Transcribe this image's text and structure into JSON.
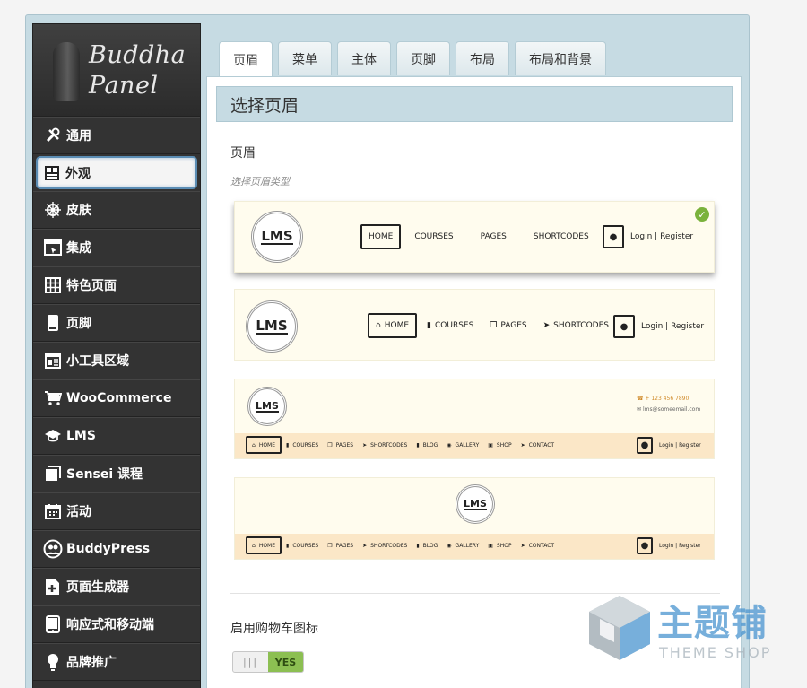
{
  "logo": {
    "line1": "Buddha",
    "line2": "Panel"
  },
  "sidebar": {
    "items": [
      {
        "label": "通用",
        "icon": "wrench-icon"
      },
      {
        "label": "外观",
        "icon": "layout-icon",
        "active": true
      },
      {
        "label": "皮肤",
        "icon": "helm-icon"
      },
      {
        "label": "集成",
        "icon": "integration-window-icon"
      },
      {
        "label": "特色页面",
        "icon": "grid-icon"
      },
      {
        "label": "页脚",
        "icon": "mobile-page-icon"
      },
      {
        "label": "小工具区域",
        "icon": "widget-layout-icon"
      },
      {
        "label": "WooCommerce",
        "icon": "cart-icon"
      },
      {
        "label": "LMS",
        "icon": "graduation-cap-icon"
      },
      {
        "label": "Sensei 课程",
        "icon": "book-stack-icon"
      },
      {
        "label": "活动",
        "icon": "calendar-icon"
      },
      {
        "label": "BuddyPress",
        "icon": "buddypress-icon"
      },
      {
        "label": "页面生成器",
        "icon": "page-builder-icon"
      },
      {
        "label": "响应式和移动端",
        "icon": "tablet-icon"
      },
      {
        "label": "品牌推广",
        "icon": "lightbulb-icon"
      }
    ]
  },
  "tabs": [
    {
      "label": "页眉",
      "active": true
    },
    {
      "label": "菜单"
    },
    {
      "label": "主体"
    },
    {
      "label": "页脚"
    },
    {
      "label": "布局"
    },
    {
      "label": "布局和背景"
    }
  ],
  "main": {
    "section_title": "选择页眉",
    "field_label": "页眉",
    "field_hint": "选择页眉类型",
    "cart_label": "启用购物车图标",
    "toggle_off": "|||",
    "toggle_yes": "YES"
  },
  "headers": {
    "logo_text": "LMS",
    "login": "Login",
    "separator": "|",
    "register": "Register",
    "phone": "+ 123 456 7890",
    "email": "lms@someemail.com",
    "h1_menu": [
      "HOME",
      "COURSES",
      "PAGES",
      "SHORTCODES"
    ],
    "h2_menu": [
      "HOME",
      "COURSES",
      "PAGES",
      "SHORTCODES"
    ],
    "h3_menu": [
      "HOME",
      "COURSES",
      "PAGES",
      "SHORTCODES",
      "BLOG",
      "GALLERY",
      "SHOP",
      "CONTACT"
    ],
    "h4_menu": [
      "HOME",
      "COURSES",
      "PAGES",
      "SHORTCODES",
      "BLOG",
      "GALLERY",
      "SHOP",
      "CONTACT"
    ]
  },
  "watermark": {
    "cn": "主题铺",
    "en": "THEME SHOP"
  },
  "colors": {
    "sidebar_bg": "#333333",
    "frame_bg": "#c6dbe3",
    "toggle_yes": "#8cbf52",
    "check": "#7ab23c",
    "header_bg": "#fffcee"
  }
}
